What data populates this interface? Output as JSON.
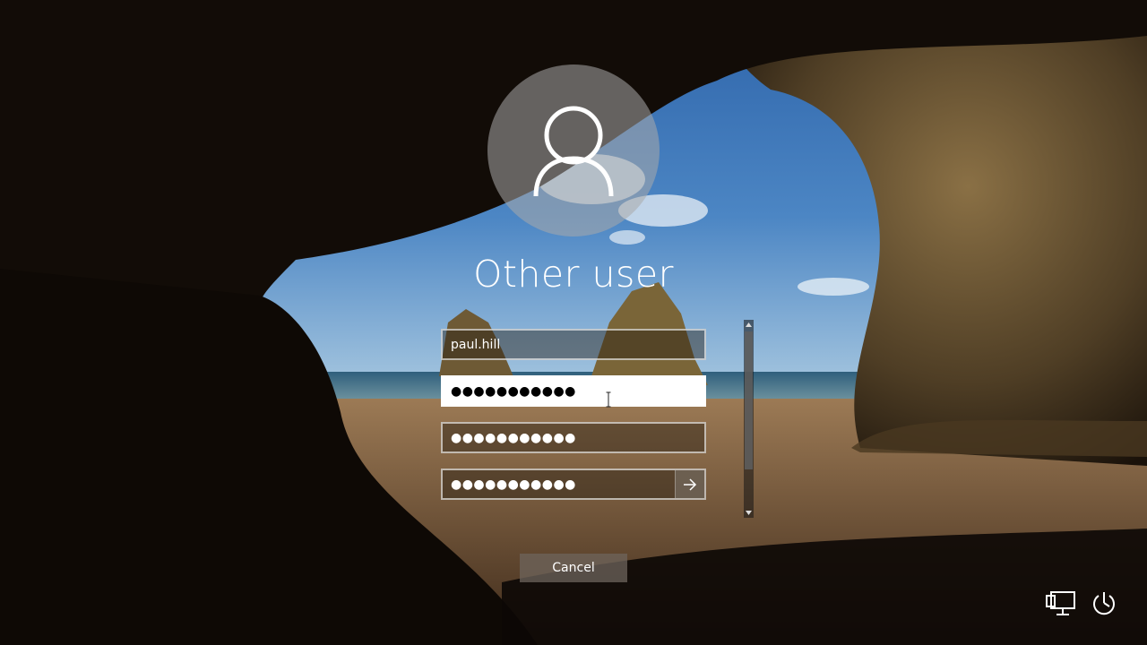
{
  "user": {
    "title": "Other user",
    "avatar_icon": "user-silhouette-icon"
  },
  "fields": {
    "username_value": "paul.hill",
    "password_mask": "●●●●●●●●●●●",
    "new_password_mask": "●●●●●●●●●●●",
    "confirm_password_mask": "●●●●●●●●●●●",
    "submit_icon": "arrow-right-icon"
  },
  "cancel_label": "Cancel",
  "corner_icons": {
    "network": "network-icon",
    "power": "power-icon"
  },
  "colors": {
    "text": "#ffffff",
    "focused_field": "#ffffff",
    "button": "#6e645c"
  }
}
